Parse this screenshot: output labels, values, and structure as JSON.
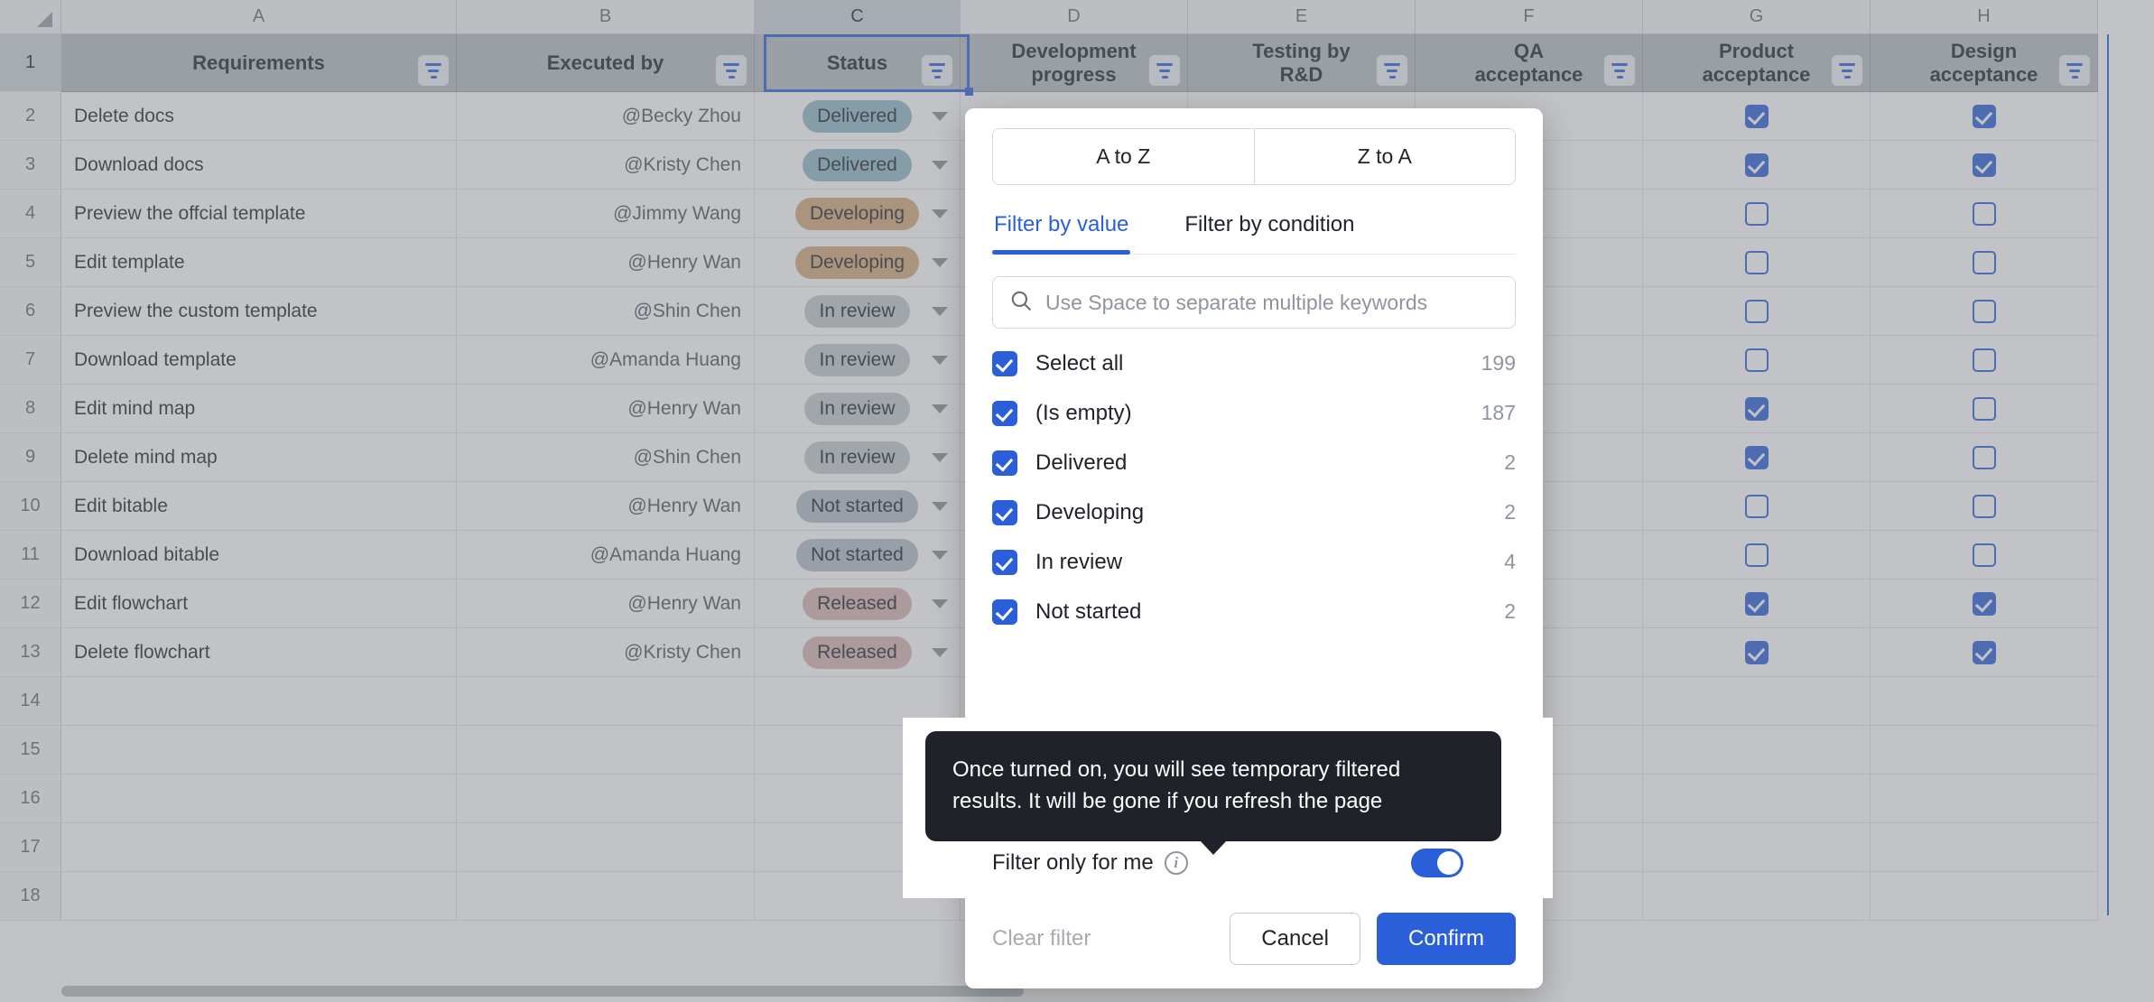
{
  "sheet": {
    "column_letters": [
      "A",
      "B",
      "C",
      "D",
      "E",
      "F",
      "G",
      "H"
    ],
    "row_numbers": [
      "1",
      "2",
      "3",
      "4",
      "5",
      "6",
      "7",
      "8",
      "9",
      "10",
      "11",
      "12",
      "13",
      "14",
      "15",
      "16",
      "17",
      "18"
    ],
    "headers": [
      {
        "line1": "Requirements",
        "line2": ""
      },
      {
        "line1": "Executed by",
        "line2": ""
      },
      {
        "line1": "Status",
        "line2": ""
      },
      {
        "line1": "Development",
        "line2": "progress"
      },
      {
        "line1": "Testing by",
        "line2": "R&D"
      },
      {
        "line1": "QA",
        "line2": "acceptance"
      },
      {
        "line1": "Product",
        "line2": "acceptance"
      },
      {
        "line1": "Design",
        "line2": "acceptance"
      }
    ],
    "selected_column": "C",
    "rows": [
      {
        "requirement": "Delete docs",
        "executed_by": "@Becky Zhou",
        "status": "Delivered",
        "product_acceptance": true,
        "design_acceptance": true
      },
      {
        "requirement": "Download docs",
        "executed_by": "@Kristy Chen",
        "status": "Delivered",
        "product_acceptance": true,
        "design_acceptance": true
      },
      {
        "requirement": "Preview the offcial template",
        "executed_by": "@Jimmy Wang",
        "status": "Developing",
        "product_acceptance": false,
        "design_acceptance": false
      },
      {
        "requirement": "Edit template",
        "executed_by": "@Henry Wan",
        "status": "Developing",
        "product_acceptance": false,
        "design_acceptance": false
      },
      {
        "requirement": "Preview the custom template",
        "executed_by": "@Shin Chen",
        "status": "In review",
        "product_acceptance": false,
        "design_acceptance": false
      },
      {
        "requirement": "Download template",
        "executed_by": "@Amanda Huang",
        "status": "In review",
        "product_acceptance": false,
        "design_acceptance": false
      },
      {
        "requirement": "Edit mind map",
        "executed_by": "@Henry Wan",
        "status": "In review",
        "product_acceptance": true,
        "design_acceptance": false
      },
      {
        "requirement": "Delete mind map",
        "executed_by": "@Shin Chen",
        "status": "In review",
        "product_acceptance": true,
        "design_acceptance": false
      },
      {
        "requirement": "Edit bitable",
        "executed_by": "@Henry Wan",
        "status": "Not started",
        "product_acceptance": false,
        "design_acceptance": false
      },
      {
        "requirement": "Download bitable",
        "executed_by": "@Amanda Huang",
        "status": "Not started",
        "product_acceptance": false,
        "design_acceptance": false
      },
      {
        "requirement": "Edit flowchart",
        "executed_by": "@Henry Wan",
        "status": "Released",
        "product_acceptance": true,
        "design_acceptance": true
      },
      {
        "requirement": "Delete flowchart",
        "executed_by": "@Kristy Chen",
        "status": "Released",
        "product_acceptance": true,
        "design_acceptance": true
      }
    ],
    "status_colors": {
      "Delivered": "#8fb9c9",
      "Developing": "#d4a97a",
      "In review": "#c5c9cd",
      "Not started": "#b4bcc8",
      "Released": "#d8b4b4"
    }
  },
  "filter_panel": {
    "sort_az_label": "A to Z",
    "sort_za_label": "Z to A",
    "tabs": [
      {
        "label": "Filter by value",
        "active": true
      },
      {
        "label": "Filter by condition",
        "active": false
      }
    ],
    "search": {
      "value": "",
      "placeholder": "Use Space to separate multiple keywords"
    },
    "values": [
      {
        "label": "Select all",
        "count": "199",
        "checked": true
      },
      {
        "label": "(Is empty)",
        "count": "187",
        "checked": true
      },
      {
        "label": "Delivered",
        "count": "2",
        "checked": true
      },
      {
        "label": "Developing",
        "count": "2",
        "checked": true
      },
      {
        "label": "In review",
        "count": "4",
        "checked": true
      },
      {
        "label": "Not started",
        "count": "2",
        "checked": true
      }
    ],
    "only_for_me": {
      "label": "Filter only for me",
      "enabled": true
    },
    "footer": {
      "clear_label": "Clear filter",
      "cancel_label": "Cancel",
      "confirm_label": "Confirm"
    },
    "accent_color": "#2b5fd9"
  },
  "tooltip": {
    "text": "Once turned on, you will see temporary filtered results. It will be gone if you refresh the page"
  }
}
